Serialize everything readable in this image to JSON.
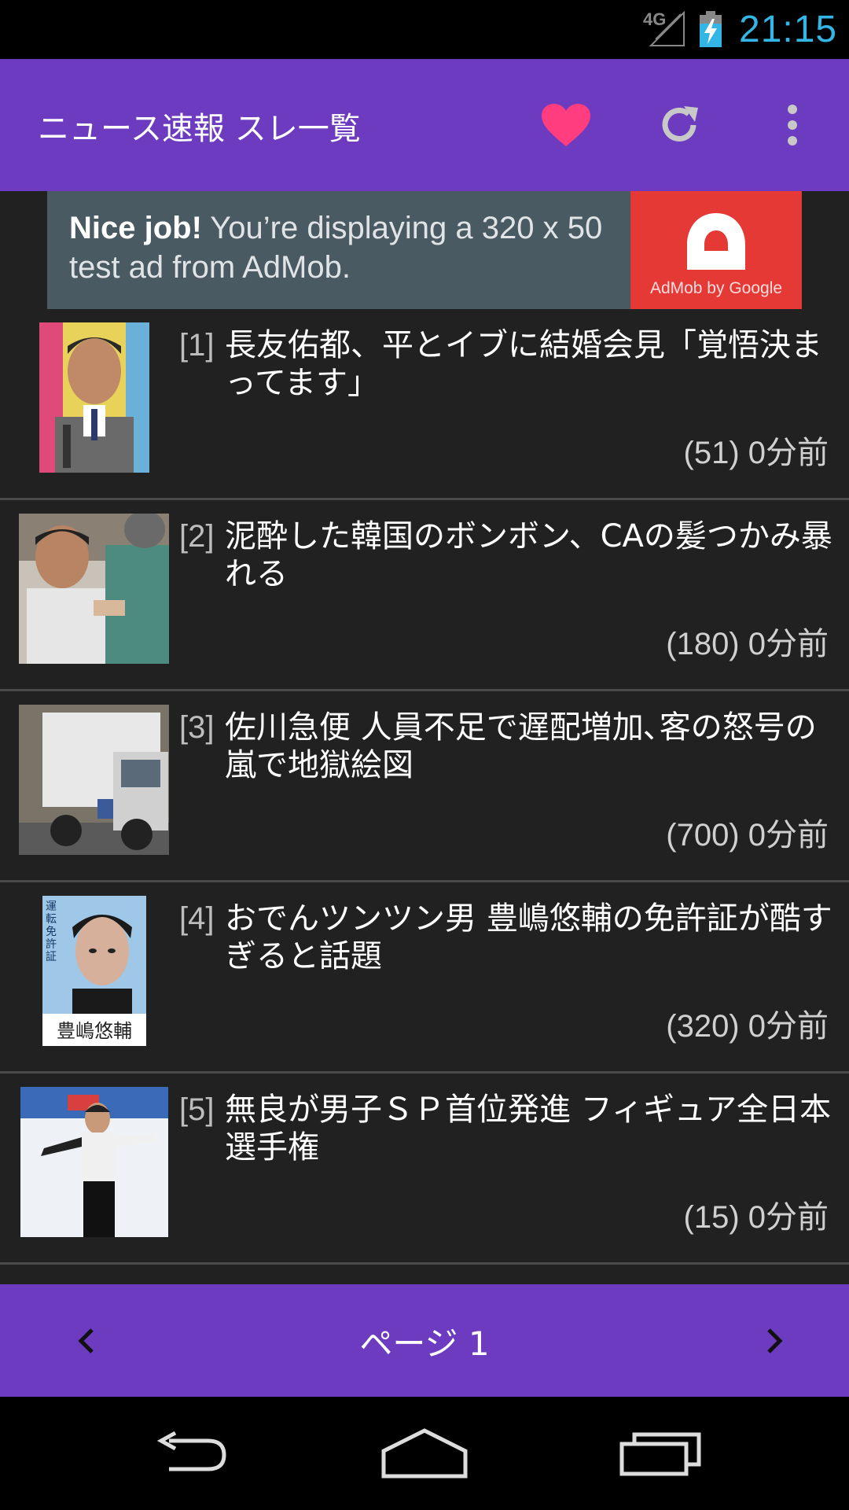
{
  "status_bar": {
    "network": "4G",
    "time": "21:15"
  },
  "app_bar": {
    "title": "ニュース速報 スレ一覧",
    "icons": [
      "heart-icon",
      "refresh-icon",
      "overflow-menu-icon"
    ],
    "colors": {
      "background": "#6c3bbf",
      "heart": "#ff3d7f"
    }
  },
  "ad": {
    "headline": "Nice job!",
    "body": " You’re displaying a 320 x 50 test ad from AdMob.",
    "logo_label": "AdMob by Google"
  },
  "items": [
    {
      "index": "[1]",
      "title": "長友佑都、平とイブに結婚会見「覚悟決まってます」",
      "meta": "(51) 0分前"
    },
    {
      "index": "[2]",
      "title": "泥酔した韓国のボンボン、CAの髪つかみ暴れる",
      "meta": "(180) 0分前"
    },
    {
      "index": "[3]",
      "title": "佐川急便 人員不足で遅配増加､客の怒号の嵐で地獄絵図",
      "meta": "(700) 0分前"
    },
    {
      "index": "[4]",
      "title": "おでんツンツン男 豊嶋悠輔の免許証が酷すぎると話題",
      "meta": "(320) 0分前",
      "thumb_caption": "豊嶋悠輔",
      "thumb_side_text": "運転免許証"
    },
    {
      "index": "[5]",
      "title": "無良が男子ＳＰ首位発進 フィギュア全日本選手権",
      "meta": "(15) 0分前"
    }
  ],
  "pager": {
    "label": "ページ 1"
  },
  "nav_bar": {
    "icons": [
      "back-icon",
      "home-icon",
      "recent-apps-icon"
    ]
  }
}
